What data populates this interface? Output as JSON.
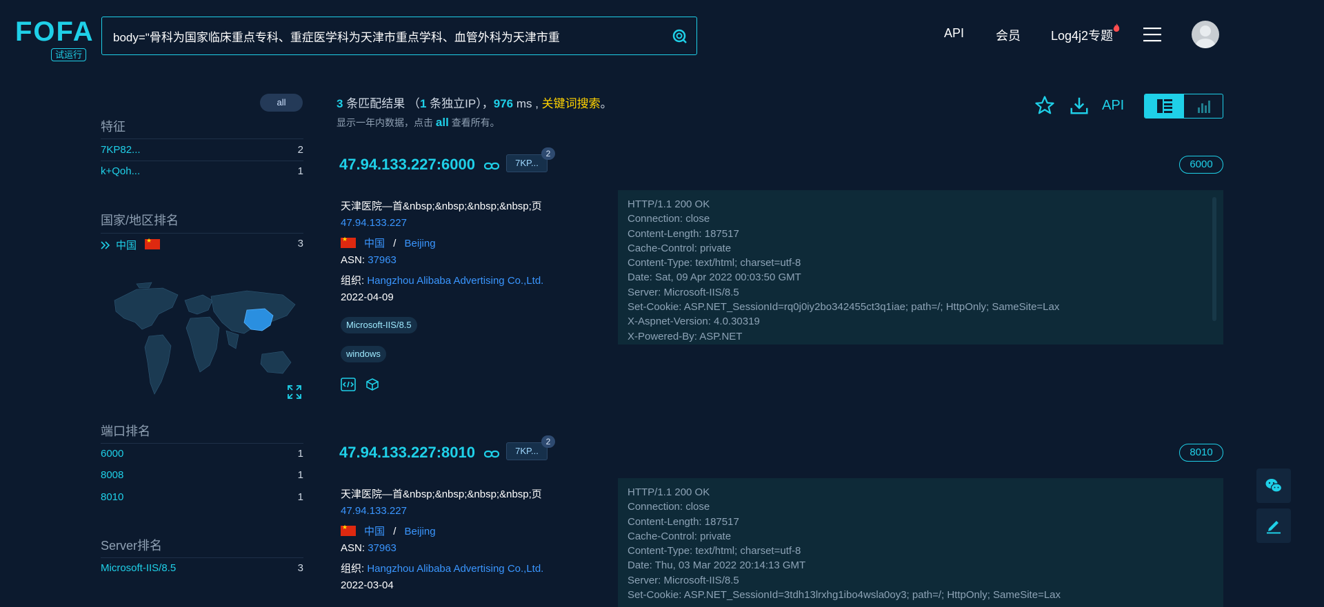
{
  "header": {
    "logo": "FOFA",
    "logo_badge": "试运行",
    "search_value": "body=\"骨科为国家临床重点专科、重症医学科为天津市重点学科、血管外科为天津市重",
    "nav": [
      "API",
      "会员",
      "Log4j2专题"
    ]
  },
  "sidebar": {
    "all_label": "all",
    "features_title": "特征",
    "features": [
      {
        "label": "7KP82...",
        "count": "2"
      },
      {
        "label": "k+Qoh...",
        "count": "1"
      }
    ],
    "country_title": "国家/地区排名",
    "countries": [
      {
        "label": "中国",
        "count": "3"
      }
    ],
    "port_title": "端口排名",
    "ports": [
      {
        "label": "6000",
        "count": "1"
      },
      {
        "label": "8008",
        "count": "1"
      },
      {
        "label": "8010",
        "count": "1"
      }
    ],
    "server_title": "Server排名",
    "servers": [
      {
        "label": "Microsoft-IIS/8.5",
        "count": "3"
      }
    ]
  },
  "summary": {
    "count": "3",
    "count_text": "条匹配结果 （",
    "ip_count": "1",
    "ip_text": "条独立IP），",
    "ms": "976",
    "ms_text": "ms ,",
    "keyword": "关键词搜索",
    "period": "。",
    "sub_text": "显示一年内数据，点击",
    "sub_link": "all",
    "sub_tail": "查看所有。"
  },
  "toolbar": {
    "api_label": "API"
  },
  "results": [
    {
      "host": "47.94.133.227:6000",
      "fp_tag": "7KP...",
      "fp_count": "2",
      "port": "6000",
      "title": "天津医院—首&nbsp;&nbsp;&nbsp;&nbsp;页",
      "ip": "47.94.133.227",
      "country": "中国",
      "sep": "/",
      "city": "Beijing",
      "asn_label": "ASN:",
      "asn": "37963",
      "org_label": "组织:",
      "org": "Hangzhou Alibaba Advertising Co.,Ltd.",
      "date": "2022-04-09",
      "chips": [
        "Microsoft-IIS/8.5",
        "windows"
      ],
      "banner": [
        "HTTP/1.1 200 OK",
        "Connection: close",
        "Content-Length: 187517",
        "Cache-Control: private",
        "Content-Type: text/html; charset=utf-8",
        "Date: Sat, 09 Apr 2022 00:03:50 GMT",
        "Server: Microsoft-IIS/8.5",
        "Set-Cookie: ASP.NET_SessionId=rq0j0iy2bo342455ct3q1iae; path=/; HttpOnly; SameSite=Lax",
        "X-Aspnet-Version: 4.0.30319",
        "X-Powered-By: ASP.NET"
      ]
    },
    {
      "host": "47.94.133.227:8010",
      "fp_tag": "7KP...",
      "fp_count": "2",
      "port": "8010",
      "title": "天津医院—首&nbsp;&nbsp;&nbsp;&nbsp;页",
      "ip": "47.94.133.227",
      "country": "中国",
      "sep": "/",
      "city": "Beijing",
      "asn_label": "ASN:",
      "asn": "37963",
      "org_label": "组织:",
      "org": "Hangzhou Alibaba Advertising Co.,Ltd.",
      "date": "2022-03-04",
      "chips": [],
      "banner": [
        "HTTP/1.1 200 OK",
        "Connection: close",
        "Content-Length: 187517",
        "Cache-Control: private",
        "Content-Type: text/html; charset=utf-8",
        "Date: Thu, 03 Mar 2022 20:14:13 GMT",
        "Server: Microsoft-IIS/8.5",
        "Set-Cookie: ASP.NET_SessionId=3tdh13lrxhg1ibo4wsla0oy3; path=/; HttpOnly; SameSite=Lax"
      ]
    }
  ],
  "colors": {
    "background": "#0c1a2e",
    "accent": "#1fd0e8",
    "link": "#3a96ff",
    "keyword": "#ffd200"
  },
  "icons": [
    "search-icon",
    "fire-icon",
    "menu-icon",
    "avatar",
    "star-icon",
    "download-icon",
    "list-view-icon",
    "chart-view-icon",
    "link-chain-icon",
    "code-icon",
    "cube-icon",
    "expand-icon",
    "wechat-icon",
    "edit-icon",
    "double-chevron-icon"
  ]
}
